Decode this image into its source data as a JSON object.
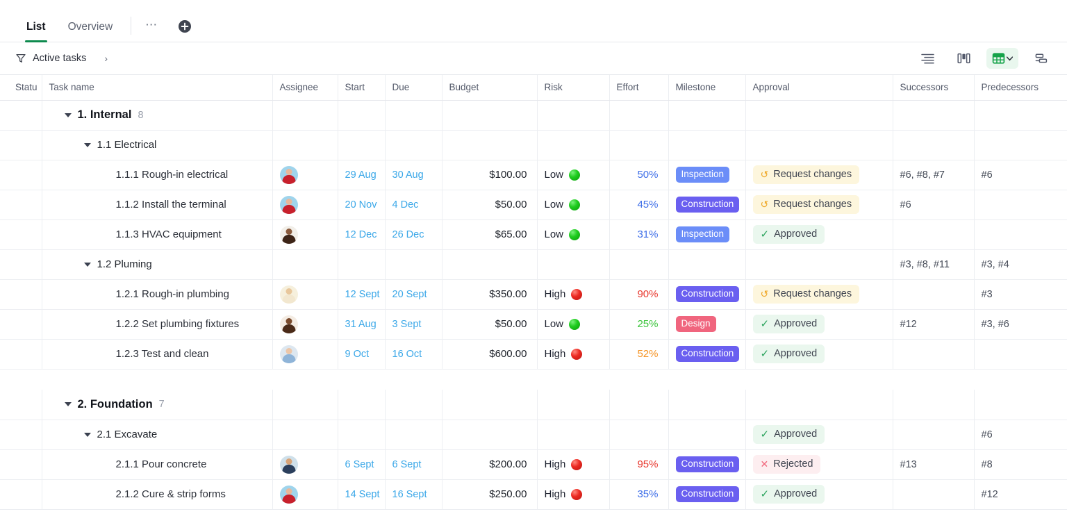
{
  "tabs": [
    {
      "label": "List",
      "active": true
    },
    {
      "label": "Overview",
      "active": false
    }
  ],
  "tab_more_label": "…",
  "tab_add_label": "add-tab",
  "filter": {
    "label": "Active tasks",
    "caret": "›",
    "icon": "funnel-icon"
  },
  "toolbar": {
    "items": [
      {
        "name": "align-lines-icon",
        "active": false
      },
      {
        "name": "kanban-columns-icon",
        "active": false
      },
      {
        "name": "table-grid-icon",
        "active": true,
        "caret": "▾"
      },
      {
        "name": "gantt-bars-icon",
        "active": false
      }
    ]
  },
  "columns": [
    {
      "key": "status",
      "label": "Statu"
    },
    {
      "key": "task",
      "label": "Task name"
    },
    {
      "key": "assignee",
      "label": "Assignee"
    },
    {
      "key": "start",
      "label": "Start"
    },
    {
      "key": "due",
      "label": "Due"
    },
    {
      "key": "budget",
      "label": "Budget"
    },
    {
      "key": "risk",
      "label": "Risk"
    },
    {
      "key": "effort",
      "label": "Effort"
    },
    {
      "key": "milestone",
      "label": "Milestone"
    },
    {
      "key": "approval",
      "label": "Approval"
    },
    {
      "key": "successors",
      "label": "Successors"
    },
    {
      "key": "predecessors",
      "label": "Predecessors"
    },
    {
      "key": "add",
      "label": "+"
    }
  ],
  "colors": {
    "accent_green": "#0e8a4e",
    "date_blue": "#3aa7e8",
    "badge_inspection": "#6b8df8",
    "badge_construction": "#6a5ff0",
    "badge_design": "#f0657e",
    "risk_low": "#20cc20",
    "risk_high": "#ec2a22",
    "approved_bg": "#eaf7ee",
    "changes_bg": "#fdf6dd",
    "rejected_bg": "#fdeef0"
  },
  "rows": [
    {
      "type": "group",
      "level": 1,
      "title": "1. Internal",
      "count": "8",
      "assignee": null,
      "start": "",
      "due": "",
      "budget": "",
      "risk": "",
      "effort": "",
      "milestone": "",
      "approval": null,
      "successors": "",
      "predecessors": ""
    },
    {
      "type": "subgroup",
      "level": 2,
      "title": "1.1 Electrical",
      "assignee": null,
      "start": "",
      "due": "",
      "budget": "",
      "risk": "",
      "effort": "",
      "milestone": "",
      "approval": null,
      "successors": "",
      "predecessors": ""
    },
    {
      "type": "task",
      "level": 3,
      "title": "1.1.1 Rough-in electrical",
      "assignee": {
        "bg": "#9fd4ec",
        "skin": "#e9b79a",
        "shirt": "#c8202c"
      },
      "start": "29 Aug",
      "due": "30 Aug",
      "budget": "$100.00",
      "risk": "Low",
      "risk_level": "low",
      "effort": "50%",
      "effort_color": "#3f6fe8",
      "milestone": "Inspection",
      "milestone_type": "inspection",
      "approval": {
        "label": "Request changes",
        "state": "changes",
        "icon": "↺"
      },
      "successors": "#6, #8, #7",
      "predecessors": "#6"
    },
    {
      "type": "task",
      "level": 3,
      "title": "1.1.2 Install the terminal",
      "assignee": {
        "bg": "#9fd4ec",
        "skin": "#e9b79a",
        "shirt": "#c8202c"
      },
      "start": "20 Nov",
      "due": "4 Dec",
      "budget": "$50.00",
      "risk": "Low",
      "risk_level": "low",
      "effort": "45%",
      "effort_color": "#3f6fe8",
      "milestone": "Construction",
      "milestone_type": "construction",
      "approval": {
        "label": "Request changes",
        "state": "changes",
        "icon": "↺"
      },
      "successors": "#6",
      "predecessors": ""
    },
    {
      "type": "task",
      "level": 3,
      "title": "1.1.3 HVAC equipment",
      "assignee": {
        "bg": "#f2efe9",
        "skin": "#8a5a3c",
        "shirt": "#3d2417"
      },
      "start": "12 Dec",
      "due": "26 Dec",
      "budget": "$65.00",
      "risk": "Low",
      "risk_level": "low",
      "effort": "31%",
      "effort_color": "#3f6fe8",
      "milestone": "Inspection",
      "milestone_type": "inspection",
      "approval": {
        "label": "Approved",
        "state": "approved",
        "icon": "✓"
      },
      "successors": "",
      "predecessors": ""
    },
    {
      "type": "subgroup",
      "level": 2,
      "title": "1.2 Pluming",
      "assignee": null,
      "start": "",
      "due": "",
      "budget": "",
      "risk": "",
      "effort": "",
      "milestone": "",
      "approval": null,
      "successors": "#3, #8, #11",
      "predecessors": "#3, #4"
    },
    {
      "type": "task",
      "level": 3,
      "title": "1.2.1 Rough-in plumbing",
      "assignee": {
        "bg": "#f6f0dd",
        "skin": "#e8c79c",
        "shirt": "#f2e7cf"
      },
      "start": "12 Sept",
      "due": "20 Sept",
      "budget": "$350.00",
      "risk": "High",
      "risk_level": "high",
      "effort": "90%",
      "effort_color": "#e8392f",
      "milestone": "Construction",
      "milestone_type": "construction",
      "approval": {
        "label": "Request changes",
        "state": "changes",
        "icon": "↺"
      },
      "successors": "",
      "predecessors": "#3"
    },
    {
      "type": "task",
      "level": 3,
      "title": "1.2.2 Set plumbing fixtures",
      "assignee": {
        "bg": "#f4ece3",
        "skin": "#7a4a2c",
        "shirt": "#4a2a18"
      },
      "start": "31 Aug",
      "due": "3 Sept",
      "budget": "$50.00",
      "risk": "Low",
      "risk_level": "low",
      "effort": "25%",
      "effort_color": "#3bc43b",
      "milestone": "Design",
      "milestone_type": "design",
      "approval": {
        "label": "Approved",
        "state": "approved",
        "icon": "✓"
      },
      "successors": "#12",
      "predecessors": "#3, #6"
    },
    {
      "type": "task",
      "level": 3,
      "title": "1.2.3 Test and clean",
      "assignee": {
        "bg": "#dde7f0",
        "skin": "#ecc6a8",
        "shirt": "#8fb4d8"
      },
      "start": "9 Oct",
      "due": "16 Oct",
      "budget": "$600.00",
      "risk": "High",
      "risk_level": "high",
      "effort": "52%",
      "effort_color": "#f59425",
      "milestone": "Construction",
      "milestone_type": "construction",
      "approval": {
        "label": "Approved",
        "state": "approved",
        "icon": "✓"
      },
      "successors": "",
      "predecessors": ""
    },
    {
      "type": "spacer"
    },
    {
      "type": "group",
      "level": 1,
      "title": "2. Foundation",
      "count": "7",
      "assignee": null,
      "start": "",
      "due": "",
      "budget": "",
      "risk": "",
      "effort": "",
      "milestone": "",
      "approval": null,
      "successors": "",
      "predecessors": ""
    },
    {
      "type": "subgroup",
      "level": 2,
      "title": "2.1 Excavate",
      "assignee": null,
      "start": "",
      "due": "",
      "budget": "",
      "risk": "",
      "effort": "",
      "milestone": "",
      "approval": {
        "label": "Approved",
        "state": "approved",
        "icon": "✓"
      },
      "successors": "",
      "predecessors": "#6"
    },
    {
      "type": "task",
      "level": 3,
      "title": "2.1.1 Pour concrete",
      "assignee": {
        "bg": "#cfe0ea",
        "skin": "#d8a478",
        "shirt": "#2b3f5c"
      },
      "start": "6 Sept",
      "due": "6 Sept",
      "budget": "$200.00",
      "risk": "High",
      "risk_level": "high",
      "effort": "95%",
      "effort_color": "#e8392f",
      "milestone": "Construction",
      "milestone_type": "construction",
      "approval": {
        "label": "Rejected",
        "state": "rejected",
        "icon": "✕"
      },
      "successors": "#13",
      "predecessors": "#8"
    },
    {
      "type": "task",
      "level": 3,
      "title": "2.1.2 Cure & strip forms",
      "assignee": {
        "bg": "#9fd4ec",
        "skin": "#e9b79a",
        "shirt": "#c8202c"
      },
      "start": "14 Sept",
      "due": "16 Sept",
      "budget": "$250.00",
      "risk": "High",
      "risk_level": "high",
      "effort": "35%",
      "effort_color": "#3f6fe8",
      "milestone": "Construction",
      "milestone_type": "construction",
      "approval": {
        "label": "Approved",
        "state": "approved",
        "icon": "✓"
      },
      "successors": "",
      "predecessors": "#12"
    }
  ]
}
